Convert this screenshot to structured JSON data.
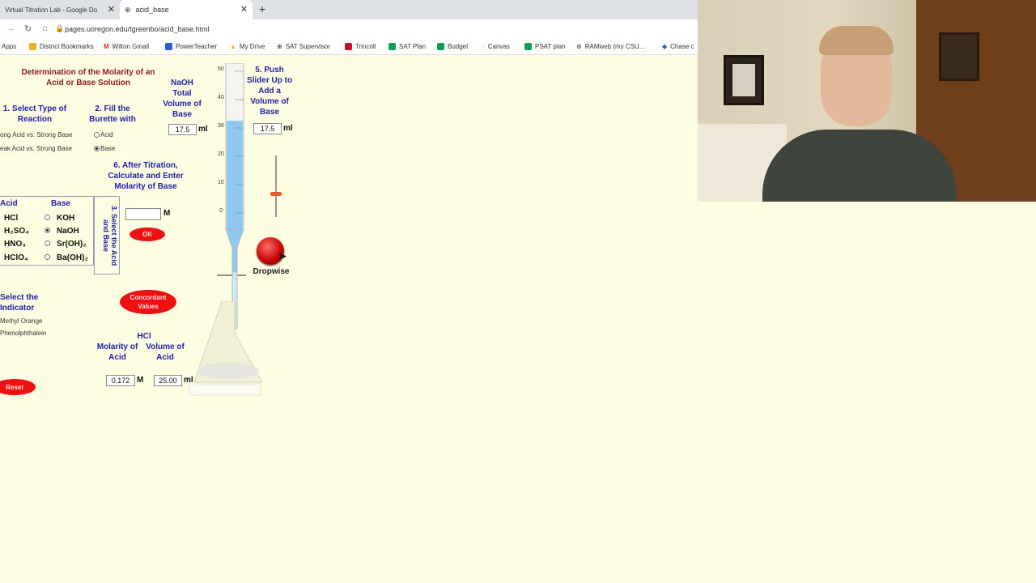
{
  "browser": {
    "tabs": [
      {
        "label": "Virtual Titration Lab - Google Do"
      },
      {
        "label": "acid_base"
      }
    ],
    "url": "pages.uoregon.edu/tgreenbo/acid_base.html",
    "bookmarks": [
      {
        "label": "Apps"
      },
      {
        "label": "District Bookmarks"
      },
      {
        "label": "Wilton Gmail"
      },
      {
        "label": "PowerTeacher"
      },
      {
        "label": "My Drive"
      },
      {
        "label": "SAT Supervisor"
      },
      {
        "label": "Trincoll"
      },
      {
        "label": "SAT Plan"
      },
      {
        "label": "Budget"
      },
      {
        "label": "Canvas"
      },
      {
        "label": "PSAT plan"
      },
      {
        "label": "RAMweb (my CSU..."
      },
      {
        "label": "Chase c"
      }
    ]
  },
  "lab": {
    "title": "Determination of the Molarity of an Acid or Base Solution",
    "step1": "1. Select Type of Reaction",
    "reaction_types": [
      "ong Acid vs. Strong Base",
      "eak Acid vs. Strong Base"
    ],
    "step2": "2. Fill the Burette with",
    "fill_options": [
      "Acid",
      "Base"
    ],
    "base_volume_header_chem": "NaOH",
    "base_volume_header": "Total Volume of Base",
    "total_volume": "17.5",
    "unit_ml": "ml",
    "step5": "5. Push Slider Up to Add a Volume of Base",
    "slider_volume": "17.5",
    "dropwise": "Dropwise",
    "step6": "6. After Titration, Calculate and Enter Molarity of Base",
    "molarity_unit": "M",
    "ok": "OK",
    "acid_header": "Acid",
    "base_header": "Base",
    "acids": [
      "HCl",
      "H₂SO₄",
      "HNO₃",
      "HClO₄"
    ],
    "bases": [
      "KOH",
      "NaOH",
      "Sr(OH)₂",
      "Ba(OH)₂"
    ],
    "selected_base": "NaOH",
    "step3": "3. Select the Acid and Base",
    "concordant": "Concordant Values",
    "step4": "Select the Indicator",
    "indicators": [
      "Methyl Orange",
      "Phenolphthalein"
    ],
    "acid_chem": "HCl",
    "molarity_acid_label": "Molarity of Acid",
    "volume_acid_label": "Volume of Acid",
    "molarity_acid": "0.172",
    "volume_acid": "25.00",
    "reset": "Reset",
    "burette_ticks": [
      "50",
      "40",
      "30",
      "20",
      "10",
      "0"
    ],
    "burette_fill_fraction": 0.35
  },
  "colors": {
    "page_bg": "#fdfde1",
    "label_blue": "#1f1fa8",
    "title_red": "#8b1a1a",
    "button_red": "#ee1111",
    "liquid_blue": "#8ec9f0"
  }
}
